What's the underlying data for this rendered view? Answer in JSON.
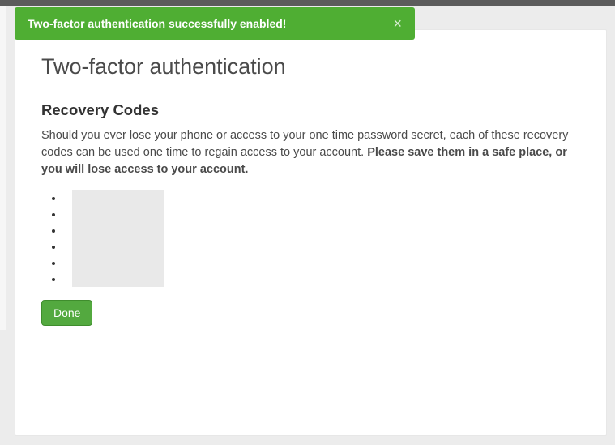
{
  "alert": {
    "message": "Two-factor authentication successfully enabled!",
    "close_glyph": "×"
  },
  "page": {
    "title": "Two-factor authentication",
    "subheading": "Recovery Codes",
    "body_lead": "Should you ever lose your phone or access to your one time password secret, each of these recovery codes can be used one time to regain access to your account. ",
    "body_emph": "Please save them in a safe place, or you will lose access to your account.",
    "codes": [
      "",
      "",
      "",
      "",
      "",
      ""
    ],
    "done_label": "Done"
  }
}
